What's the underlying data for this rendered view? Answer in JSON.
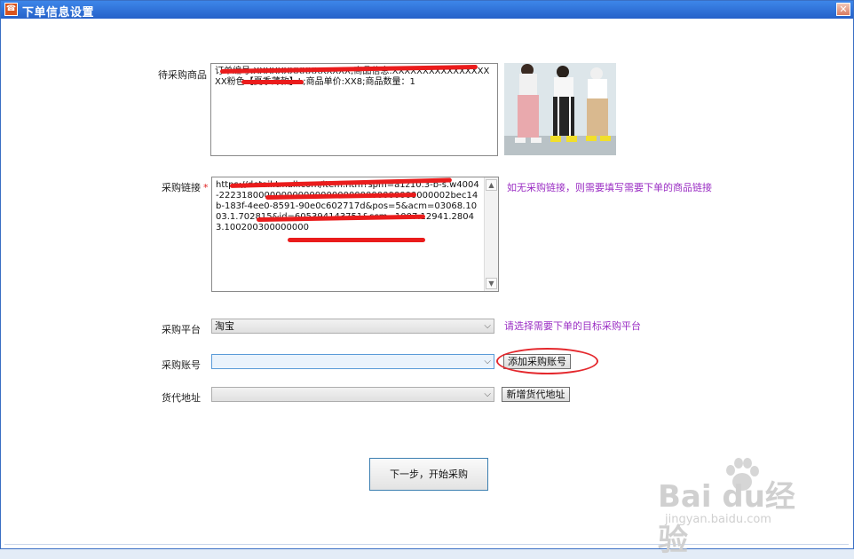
{
  "window": {
    "title": "下单信息设置",
    "close_glyph": "✕"
  },
  "form": {
    "product_label": "待采购商品",
    "product_text": "订单编号:XXXXXXXXXXXXXXXX;商品信息:XXXXXXXXXXXXXXXXXX粉色【夏季薄款】L;商品单价:XX8;商品数量：1",
    "link_label": "采购链接",
    "link_required": "*",
    "link_text": "https://detail.tmall.com/item.htm?spm=a1z10.3-b-s.w4004-22231800000000000000000000000000000000002bec14b-183f-4ee0-8591-90e0c602717d&pos=5&acm=03068.1003.1.702815&id=605394143751&scm=1007.12941.28043.100200300000000",
    "link_hint": "如无采购链接，则需要填写需要下单的商品链接",
    "platform_label": "采购平台",
    "platform_value": "淘宝",
    "platform_hint": "请选择需要下单的目标采购平台",
    "account_label": "采购账号",
    "account_value": "",
    "add_account_button": "添加采购账号",
    "forwarder_label": "货代地址",
    "forwarder_value": "",
    "add_forwarder_button": "新增货代地址",
    "next_button": "下一步，开始采购"
  },
  "watermark": {
    "brand": "Bai du经验",
    "url": "jingyan.baidu.com"
  },
  "colors": {
    "titlebar": "#2e6fd9",
    "hint": "#9b2fc4",
    "required": "#e02020",
    "annotation": "#e4282d",
    "redaction": "#ea1c1c"
  }
}
